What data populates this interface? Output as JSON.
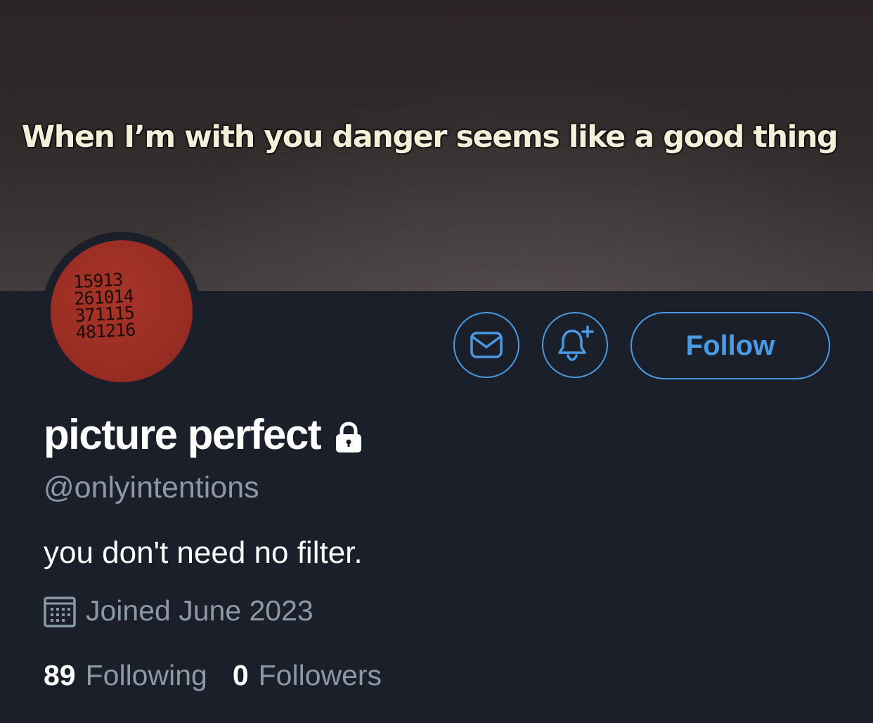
{
  "banner": {
    "caption": "When I’m with you danger seems like a good thing"
  },
  "avatar": {
    "lines": [
      "15913",
      "261014",
      "371115",
      "481216"
    ]
  },
  "actions": {
    "message_icon": "envelope-icon",
    "notify_icon": "bell-plus-icon",
    "follow_label": "Follow"
  },
  "profile": {
    "display_name": "picture perfect",
    "protected_icon": "lock-icon",
    "handle": "@onlyintentions",
    "bio": "you don't need no filter.",
    "joined_icon": "calendar-icon",
    "joined": "Joined June 2023"
  },
  "stats": {
    "following_count": "89",
    "following_label": "Following",
    "followers_count": "0",
    "followers_label": "Followers"
  },
  "colors": {
    "background": "#1a1f2a",
    "accent": "#4a9ae6",
    "secondary_text": "#8b98a5",
    "avatar_red": "#9a2d24"
  }
}
